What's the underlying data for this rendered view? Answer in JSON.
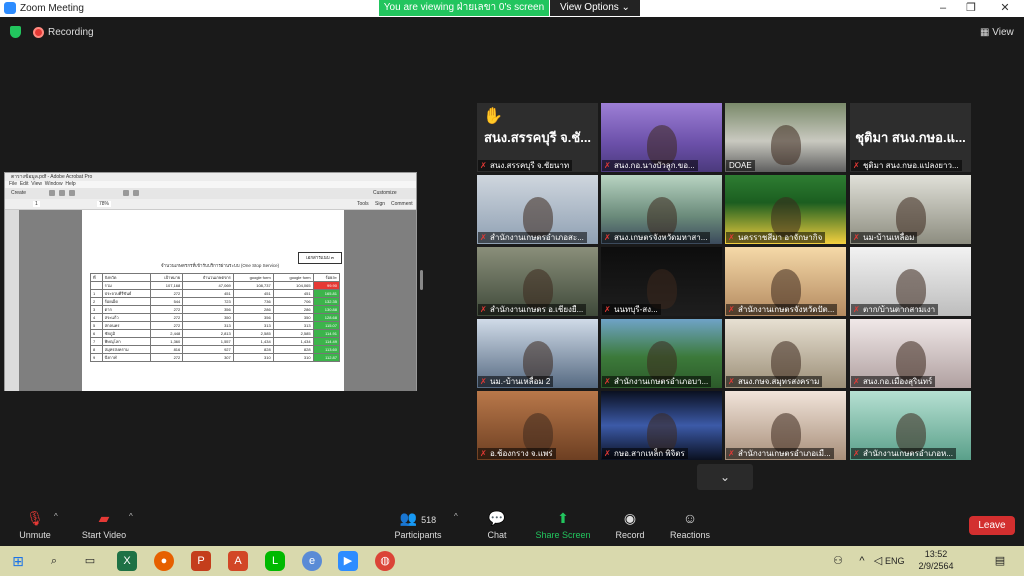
{
  "window": {
    "title": "Zoom Meeting"
  },
  "banner": {
    "viewing_text": "You are viewing ฝ่ายเลขา 0's screen",
    "view_options": "View Options"
  },
  "meeting": {
    "recording_label": "Recording",
    "view_label": "View"
  },
  "shared_screen": {
    "pdf_title": "ตารางข้อมูล.pdf - Adobe Acrobat Pro",
    "menu": [
      "File",
      "Edit",
      "View",
      "Window",
      "Help"
    ],
    "create_label": "Create",
    "customize_label": "Customize",
    "zoom_value": "78%",
    "page_value": "1",
    "pane_tools": "Tools",
    "pane_sign": "Sign",
    "pane_comment": "Comment",
    "heading": "จำนวนเกษตรกรที่เข้ารับบริการผ่านระบบ (One Stop Service)",
    "box_label": "เอกสารแนบ ๓",
    "table_headers": [
      "ที่",
      "จังหวัด",
      "เป้าหมาย",
      "จำนวนเกษตรกร",
      "google form",
      "google form",
      "ร้อยละ"
    ],
    "table_rows": [
      [
        "",
        "รวม",
        "107,168",
        "47,069",
        "108,737",
        "104,065",
        "99.90"
      ],
      [
        "1",
        "ประจวบคีรีขันธ์",
        "272",
        "451",
        "451",
        "451",
        "165.81"
      ],
      [
        "2",
        "ร้อยเอ็ด",
        "544",
        "723",
        "736",
        "706",
        "132.35"
      ],
      [
        "3",
        "ตาก",
        "272",
        "356",
        "286",
        "286",
        "130.88"
      ],
      [
        "4",
        "สระแก้ว",
        "272",
        "350",
        "356",
        "350",
        "128.68"
      ],
      [
        "5",
        "สกลนคร",
        "272",
        "313",
        "313",
        "313",
        "115.07"
      ],
      [
        "6",
        "ชัยภูมิ",
        "2,448",
        "2,813",
        "2,585",
        "2,585",
        "114.91"
      ],
      [
        "7",
        "พิษณุโลก",
        "1,360",
        "1,557",
        "1,434",
        "1,434",
        "114.49"
      ],
      [
        "8",
        "สมุทรสงคราม",
        "816",
        "927",
        "828",
        "828",
        "113.60"
      ],
      [
        "9",
        "บึงกาฬ",
        "272",
        "307",
        "310",
        "310",
        "112.87"
      ]
    ]
  },
  "participants": [
    {
      "name": "สนง.สรรคบุรี จ.ชัยนาท",
      "big_label": "สนง.สรรคบุรี จ.ชั...",
      "hand": true,
      "muted": true
    },
    {
      "name": "สนง.กอ.นางบัวลูก.ขอ...",
      "muted": true
    },
    {
      "name": "DOAE",
      "muted": false,
      "active": true
    },
    {
      "name": "ชุติมา สนง.กษอ.แปลงยาว...",
      "big_label": "ชุติมา สนง.กษอ.แ...",
      "muted": true
    },
    {
      "name": "สำนักงานเกษตรอำเภอสะ...",
      "muted": true
    },
    {
      "name": "สนง.เกษตรจังหวัดมหาสา...",
      "muted": true
    },
    {
      "name": "นครราชสีมา อาจักษากิจ",
      "muted": true
    },
    {
      "name": "นม-บ้านเหลื่อม",
      "muted": true
    },
    {
      "name": "สำนักงานเกษตร อ.เชียงยื...",
      "muted": true
    },
    {
      "name": "นนทบุรี-สง...",
      "muted": true
    },
    {
      "name": "สำนักงานเกษตรจังหวัดปัต...",
      "muted": true
    },
    {
      "name": "ตาก/บ้านตากสามเงา",
      "muted": true
    },
    {
      "name": "นม.-บ้านเหลื่อม 2",
      "muted": true
    },
    {
      "name": "สำนักงานเกษตรอำเภอบา...",
      "muted": true
    },
    {
      "name": "สนง.กษจ.สมุทรสงคราม",
      "muted": true
    },
    {
      "name": "สนง.กอ.เมืองสุรินทร์",
      "muted": true
    },
    {
      "name": "อ.ช้องกราง จ.แพร่",
      "muted": true
    },
    {
      "name": "กษอ.สากเหล็ก พิจิตร",
      "muted": true
    },
    {
      "name": "สำนักงานเกษตรอำเภอเมื...",
      "muted": true
    },
    {
      "name": "สำนักงานเกษตรอำเภอห...",
      "muted": true
    }
  ],
  "toolbar": {
    "unmute": "Unmute",
    "start_video": "Start Video",
    "participants": "Participants",
    "participants_count": "518",
    "chat": "Chat",
    "share_screen": "Share Screen",
    "record": "Record",
    "reactions": "Reactions",
    "leave": "Leave"
  },
  "taskbar": {
    "time": "13:52",
    "date": "2/9/2564",
    "language": "ENG"
  },
  "colors": {
    "share_green": "#22c55e",
    "leave_red": "#d32f2f",
    "taskbar": "#d9d9ad",
    "active_speaker": "#c6e23a"
  }
}
